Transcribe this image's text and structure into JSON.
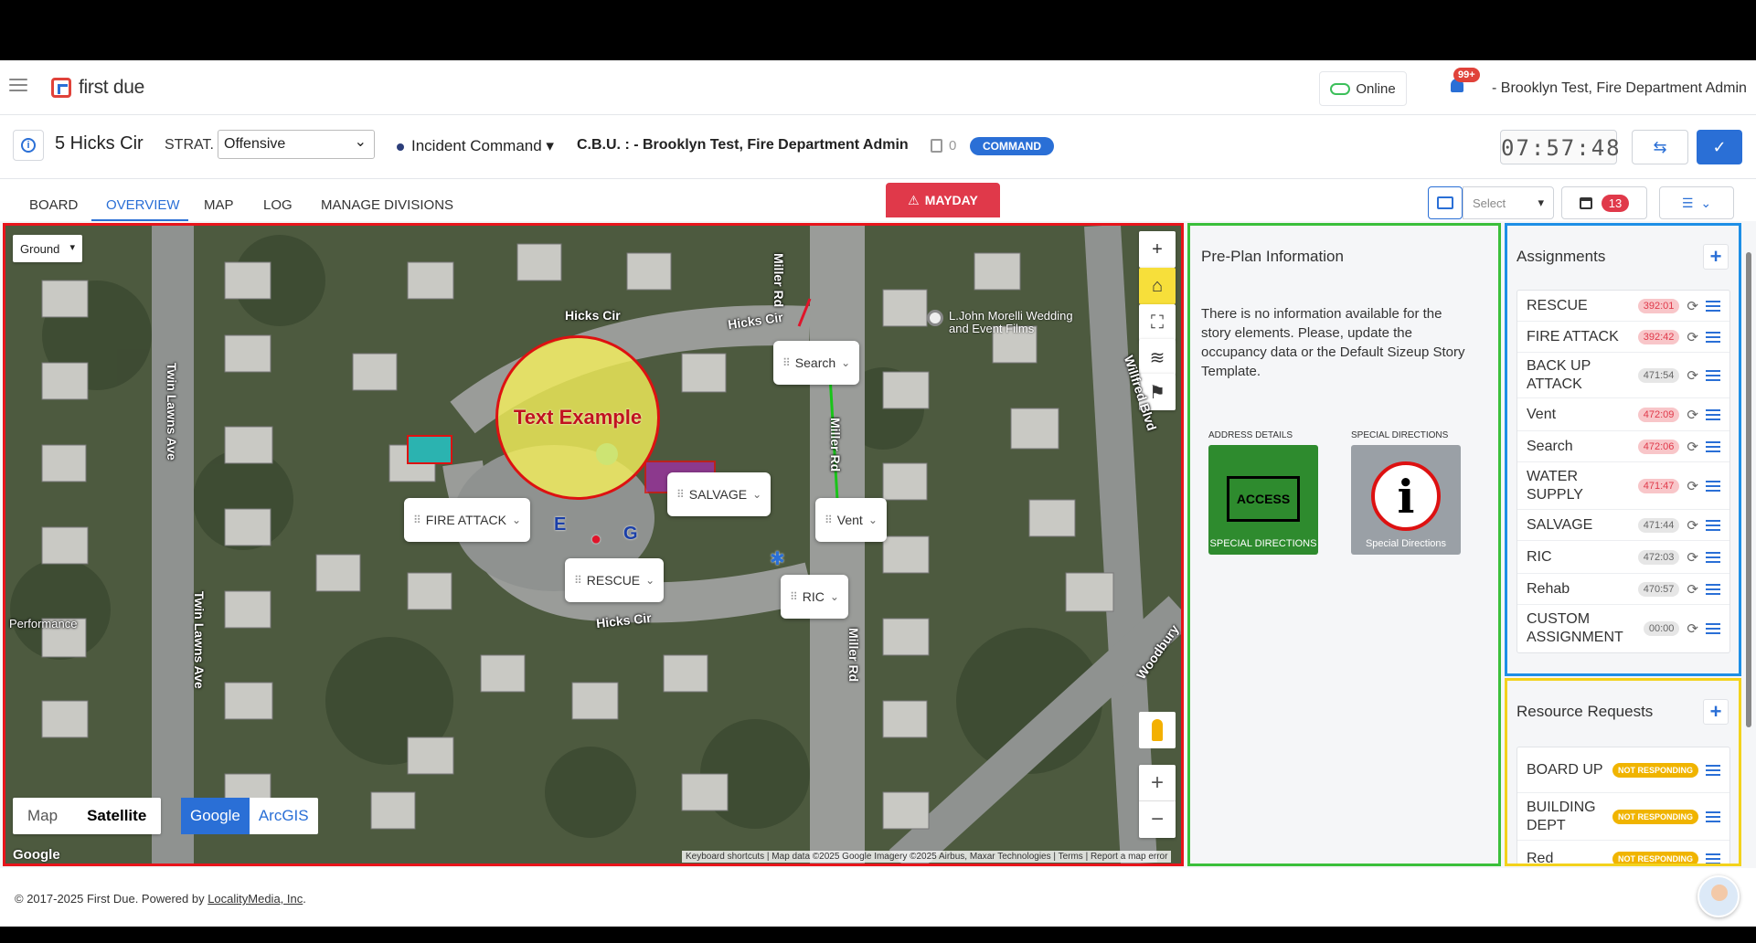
{
  "app": {
    "name": "first due"
  },
  "topnav": {
    "online_label": "Online",
    "notif_count": "99+",
    "user": "- Brooklyn Test, Fire Department Admin"
  },
  "incident": {
    "address": "5 Hicks Cir",
    "strat_label": "STRAT.",
    "strat_value": "Offensive",
    "command_role": "Incident Command",
    "cbu": "C.B.U. : - Brooklyn Test, Fire Department Admin",
    "copy_count": "0",
    "command_badge": "COMMAND",
    "clock": "07:57:48"
  },
  "tabs": [
    {
      "label": "BOARD"
    },
    {
      "label": "OVERVIEW"
    },
    {
      "label": "MAP"
    },
    {
      "label": "LOG"
    },
    {
      "label": "MANAGE DIVISIONS"
    }
  ],
  "mayday_label": "MAYDAY",
  "toolbar": {
    "select_placeholder": "Select",
    "calendar_count": "13"
  },
  "map": {
    "ground_label": "Ground",
    "text_example": "Text Example",
    "assignments": {
      "search": "Search",
      "salvage": "SALVAGE",
      "vent": "Vent",
      "fire_attack": "FIRE ATTACK",
      "rescue": "RESCUE",
      "ric": "RIC"
    },
    "streets": {
      "hicks1": "Hicks Cir",
      "hicks2": "Hicks Cir",
      "hicks3": "Hicks Cir",
      "miller1": "Miller Rd",
      "miller2": "Miller Rd",
      "miller3": "Miller Rd",
      "twin1": "Twin Lawns Ave",
      "twin2": "Twin Lawns Ave",
      "willfred": "Willfred Blvd",
      "woodbury": "Woodbury",
      "performance": "Performance"
    },
    "poi": "L.John Morelli Wedding and Event Films",
    "map_types": [
      "Map",
      "Satellite"
    ],
    "providers": [
      "Google",
      "ArcGIS"
    ],
    "google_logo": "Google",
    "attribution": "Keyboard shortcuts | Map data ©2025 Google Imagery ©2025 Airbus, Maxar Technologies | Terms | Report a map error"
  },
  "preplan": {
    "title": "Pre-Plan Information",
    "message": "There is no information available for the story elements. Please, update the occupancy data or the Default Sizeup Story Template.",
    "address_caption": "ADDRESS DETAILS",
    "special_caption": "SPECIAL DIRECTIONS",
    "access_box": "ACCESS",
    "access_label": "SPECIAL DIRECTIONS",
    "info_label": "Special Directions"
  },
  "assignments_panel": {
    "title": "Assignments",
    "rows": [
      {
        "name": "RESCUE",
        "timer": "392:01",
        "status": "red"
      },
      {
        "name": "FIRE ATTACK",
        "timer": "392:42",
        "status": "red"
      },
      {
        "name": "BACK UP ATTACK",
        "timer": "471:54",
        "status": "grey"
      },
      {
        "name": "Vent",
        "timer": "472:09",
        "status": "red"
      },
      {
        "name": "Search",
        "timer": "472:06",
        "status": "red"
      },
      {
        "name": "WATER SUPPLY",
        "timer": "471:47",
        "status": "red"
      },
      {
        "name": "SALVAGE",
        "timer": "471:44",
        "status": "grey"
      },
      {
        "name": "RIC",
        "timer": "472:03",
        "status": "grey"
      },
      {
        "name": "Rehab",
        "timer": "470:57",
        "status": "grey"
      },
      {
        "name": "CUSTOM ASSIGNMENT",
        "timer": "00:00",
        "status": "grey"
      }
    ]
  },
  "resource_requests": {
    "title": "Resource Requests",
    "rows": [
      {
        "name": "BOARD UP",
        "status": "NOT RESPONDING"
      },
      {
        "name": "BUILDING DEPT",
        "status": "NOT RESPONDING"
      },
      {
        "name": "Red",
        "status": "NOT RESPONDING"
      }
    ]
  },
  "footer": {
    "copyright": "© 2017-2025 First Due. Powered by ",
    "link": "LocalityMedia, Inc",
    "period": "."
  }
}
